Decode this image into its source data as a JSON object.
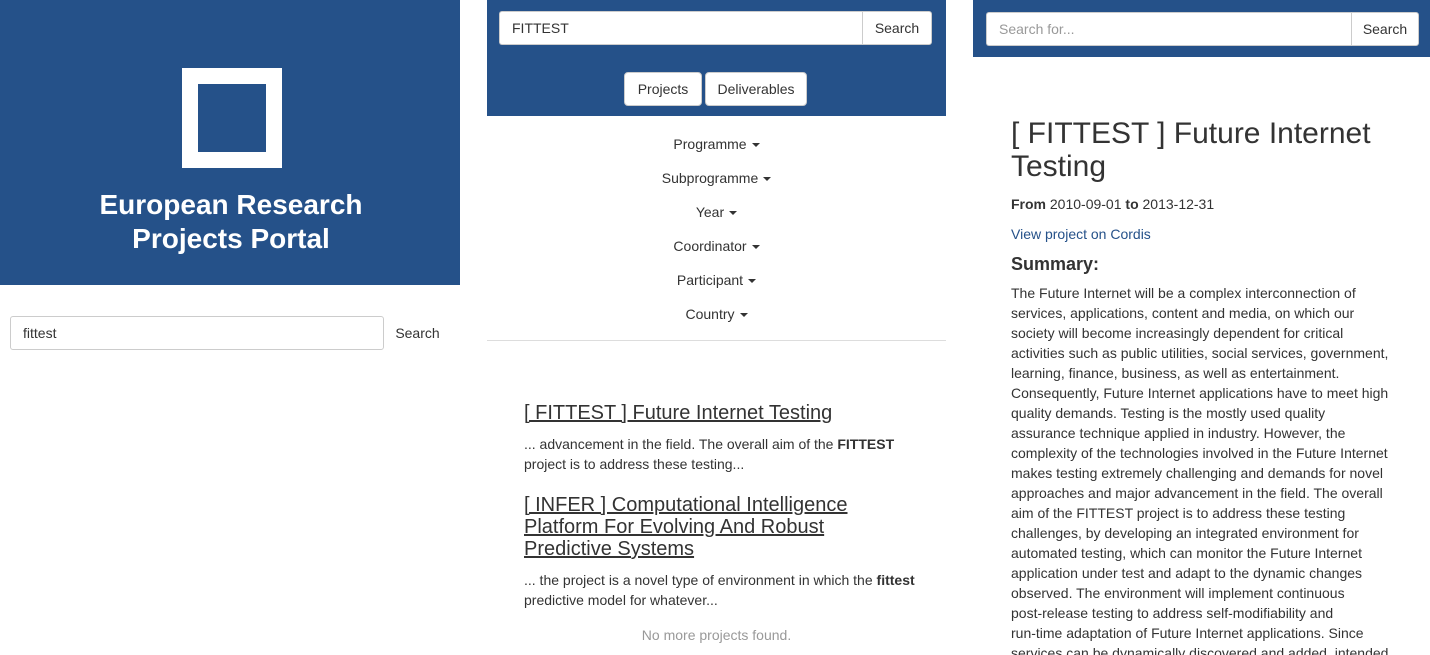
{
  "panel1": {
    "portal_title_line1": "European Research",
    "portal_title_line2": "Projects Portal",
    "search_value": "fittest",
    "search_button": "Search"
  },
  "panel2": {
    "search_value": "FITTEST",
    "search_button": "Search",
    "tabs": [
      "Projects",
      "Deliverables"
    ],
    "filters": [
      "Programme",
      "Subprogramme",
      "Year",
      "Coordinator",
      "Participant",
      "Country"
    ],
    "results": [
      {
        "title": "[ FITTEST ] Future Internet Testing",
        "snippet_before": "... advancement in the field.   The overall aim of the ",
        "snippet_highlight": "FITTEST",
        "snippet_after": " project is to address these testing..."
      },
      {
        "title": "[ INFER ] Computational Intelligence Platform For Evolving And Robust Predictive Systems",
        "snippet_before": "... the project is a novel type of environment in which the ",
        "snippet_highlight": "fittest",
        "snippet_after": " predictive model for whatever..."
      }
    ],
    "no_more": "No more projects found."
  },
  "panel3": {
    "search_placeholder": "Search for...",
    "search_button": "Search",
    "project_title": "[ FITTEST ] Future Internet Testing",
    "from_label": "From",
    "from_date": "2010-09-01",
    "to_label": "to",
    "to_date": "2013-12-31",
    "cordis_link": "View project on Cordis",
    "summary_heading": "Summary:",
    "summary_lines": [
      "The Future Internet will be a complex interconnection of",
      "services, applications, content and media, on which our",
      "society will become increasingly dependent for critical",
      "activities such as public utilities, social services, government,",
      "learning, finance, business, as well as entertainment.",
      "Consequently, Future Internet applications have to meet high",
      "quality demands.   Testing is the mostly used quality",
      "assurance technique applied in industry. However, the",
      "complexity of the technologies involved in the Future Internet",
      "makes testing extremely challenging and demands for novel",
      "approaches and major advancement in the field.   The overall",
      "aim of the FITTEST project is to address these testing",
      "challenges, by developing an integrated environment for",
      "automated testing, which can monitor the Future Internet",
      "application under test and adapt to the dynamic changes",
      "observed.   The environment will implement continuous",
      "post-release testing to address self-modifiability and",
      "run-time adaptation of Future Internet applications. Since",
      "services can be dynamically discovered and added, intended"
    ]
  },
  "colors": {
    "brand_blue": "#255189",
    "muted_text": "#999999"
  },
  "icons": {
    "logo": "square-logo-icon",
    "dropdown": "caret-down-icon"
  }
}
